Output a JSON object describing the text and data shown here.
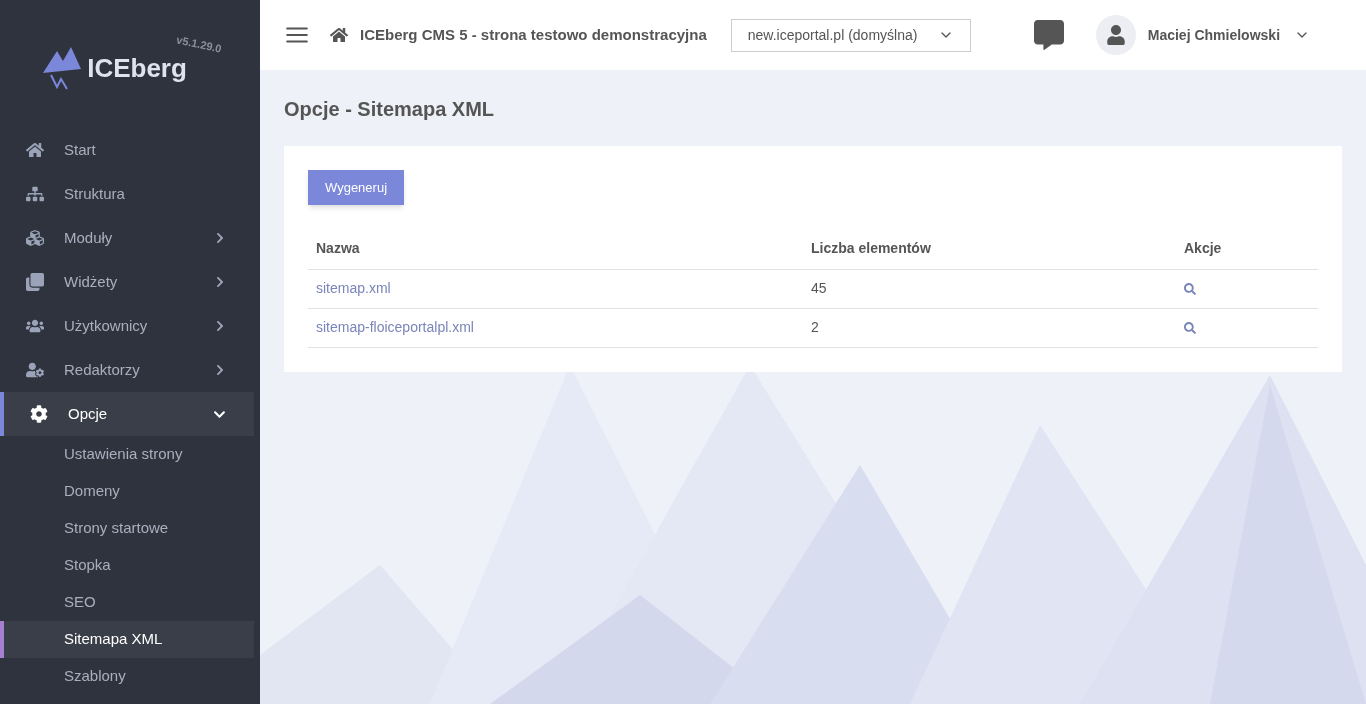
{
  "sidebar": {
    "logo": {
      "name": "ICEberg",
      "version": "v5.1.29.0"
    },
    "items": [
      {
        "label": "Start",
        "has_submenu": false,
        "expanded": false,
        "selected": false
      },
      {
        "label": "Struktura",
        "has_submenu": false,
        "expanded": false,
        "selected": false
      },
      {
        "label": "Moduły",
        "has_submenu": true,
        "expanded": false,
        "selected": false
      },
      {
        "label": "Widżety",
        "has_submenu": true,
        "expanded": false,
        "selected": false
      },
      {
        "label": "Użytkownicy",
        "has_submenu": true,
        "expanded": false,
        "selected": false
      },
      {
        "label": "Redaktorzy",
        "has_submenu": true,
        "expanded": false,
        "selected": false
      },
      {
        "label": "Opcje",
        "has_submenu": true,
        "expanded": true,
        "selected": true,
        "children": [
          {
            "label": "Ustawienia strony",
            "selected": false
          },
          {
            "label": "Domeny",
            "selected": false
          },
          {
            "label": "Strony startowe",
            "selected": false
          },
          {
            "label": "Stopka",
            "selected": false
          },
          {
            "label": "SEO",
            "selected": false
          },
          {
            "label": "Sitemapa XML",
            "selected": true
          },
          {
            "label": "Szablony",
            "selected": false
          }
        ]
      }
    ]
  },
  "header": {
    "title": "ICEberg CMS 5 - strona testowo demonstracyjna",
    "domain_select": "new.iceportal.pl (domyślna)",
    "user": "Maciej Chmielowski"
  },
  "page": {
    "title": "Opcje - Sitemapa XML",
    "button": "Wygeneruj",
    "table": {
      "columns": [
        "Nazwa",
        "Liczba elementów",
        "Akcje"
      ],
      "rows": [
        {
          "name": "sitemap.xml",
          "count": "45"
        },
        {
          "name": "sitemap-floiceportalpl.xml",
          "count": "2"
        }
      ]
    }
  }
}
